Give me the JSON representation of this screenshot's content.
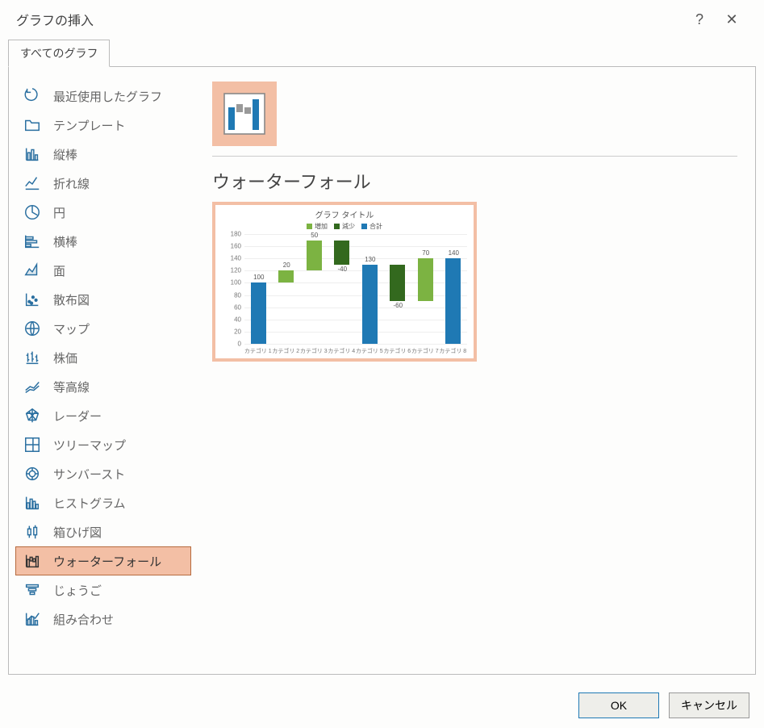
{
  "dialog": {
    "title": "グラフの挿入"
  },
  "tabs": {
    "all": "すべてのグラフ"
  },
  "sidebar": {
    "items": [
      {
        "label": "最近使用したグラフ"
      },
      {
        "label": "テンプレート"
      },
      {
        "label": "縦棒"
      },
      {
        "label": "折れ線"
      },
      {
        "label": "円"
      },
      {
        "label": "横棒"
      },
      {
        "label": "面"
      },
      {
        "label": "散布図"
      },
      {
        "label": "マップ"
      },
      {
        "label": "株価"
      },
      {
        "label": "等高線"
      },
      {
        "label": "レーダー"
      },
      {
        "label": "ツリーマップ"
      },
      {
        "label": "サンバースト"
      },
      {
        "label": "ヒストグラム"
      },
      {
        "label": "箱ひげ図"
      },
      {
        "label": "ウォーターフォール"
      },
      {
        "label": "じょうご"
      },
      {
        "label": "組み合わせ"
      }
    ]
  },
  "chart": {
    "name": "ウォーターフォール",
    "preview_title": "グラフ タイトル",
    "legend": {
      "increase": "増加",
      "decrease": "減少",
      "total": "合計"
    }
  },
  "chart_data": {
    "type": "waterfall",
    "title": "グラフ タイトル",
    "ylim": [
      0,
      180
    ],
    "yticks": [
      0,
      20,
      40,
      60,
      80,
      100,
      120,
      140,
      160,
      180
    ],
    "categories": [
      "カテゴリ 1",
      "カテゴリ 2",
      "カテゴリ 3",
      "カテゴリ 4",
      "カテゴリ 5",
      "カテゴリ 6",
      "カテゴリ 7",
      "カテゴリ 8"
    ],
    "series_legend": [
      "増加",
      "減少",
      "合計"
    ],
    "points": [
      {
        "label": "カテゴリ 1",
        "value": 100,
        "kind": "total",
        "start": 0,
        "end": 100
      },
      {
        "label": "カテゴリ 2",
        "value": 20,
        "kind": "increase",
        "start": 100,
        "end": 120
      },
      {
        "label": "カテゴリ 3",
        "value": 50,
        "kind": "increase",
        "start": 120,
        "end": 170
      },
      {
        "label": "カテゴリ 4",
        "value": -40,
        "kind": "decrease",
        "start": 170,
        "end": 130
      },
      {
        "label": "カテゴリ 5",
        "value": 130,
        "kind": "total",
        "start": 0,
        "end": 130
      },
      {
        "label": "カテゴリ 6",
        "value": -60,
        "kind": "decrease",
        "start": 130,
        "end": 70
      },
      {
        "label": "カテゴリ 7",
        "value": 70,
        "kind": "increase",
        "start": 70,
        "end": 140
      },
      {
        "label": "カテゴリ 8",
        "value": 140,
        "kind": "total",
        "start": 0,
        "end": 140
      }
    ]
  },
  "footer": {
    "ok": "OK",
    "cancel": "キャンセル"
  }
}
